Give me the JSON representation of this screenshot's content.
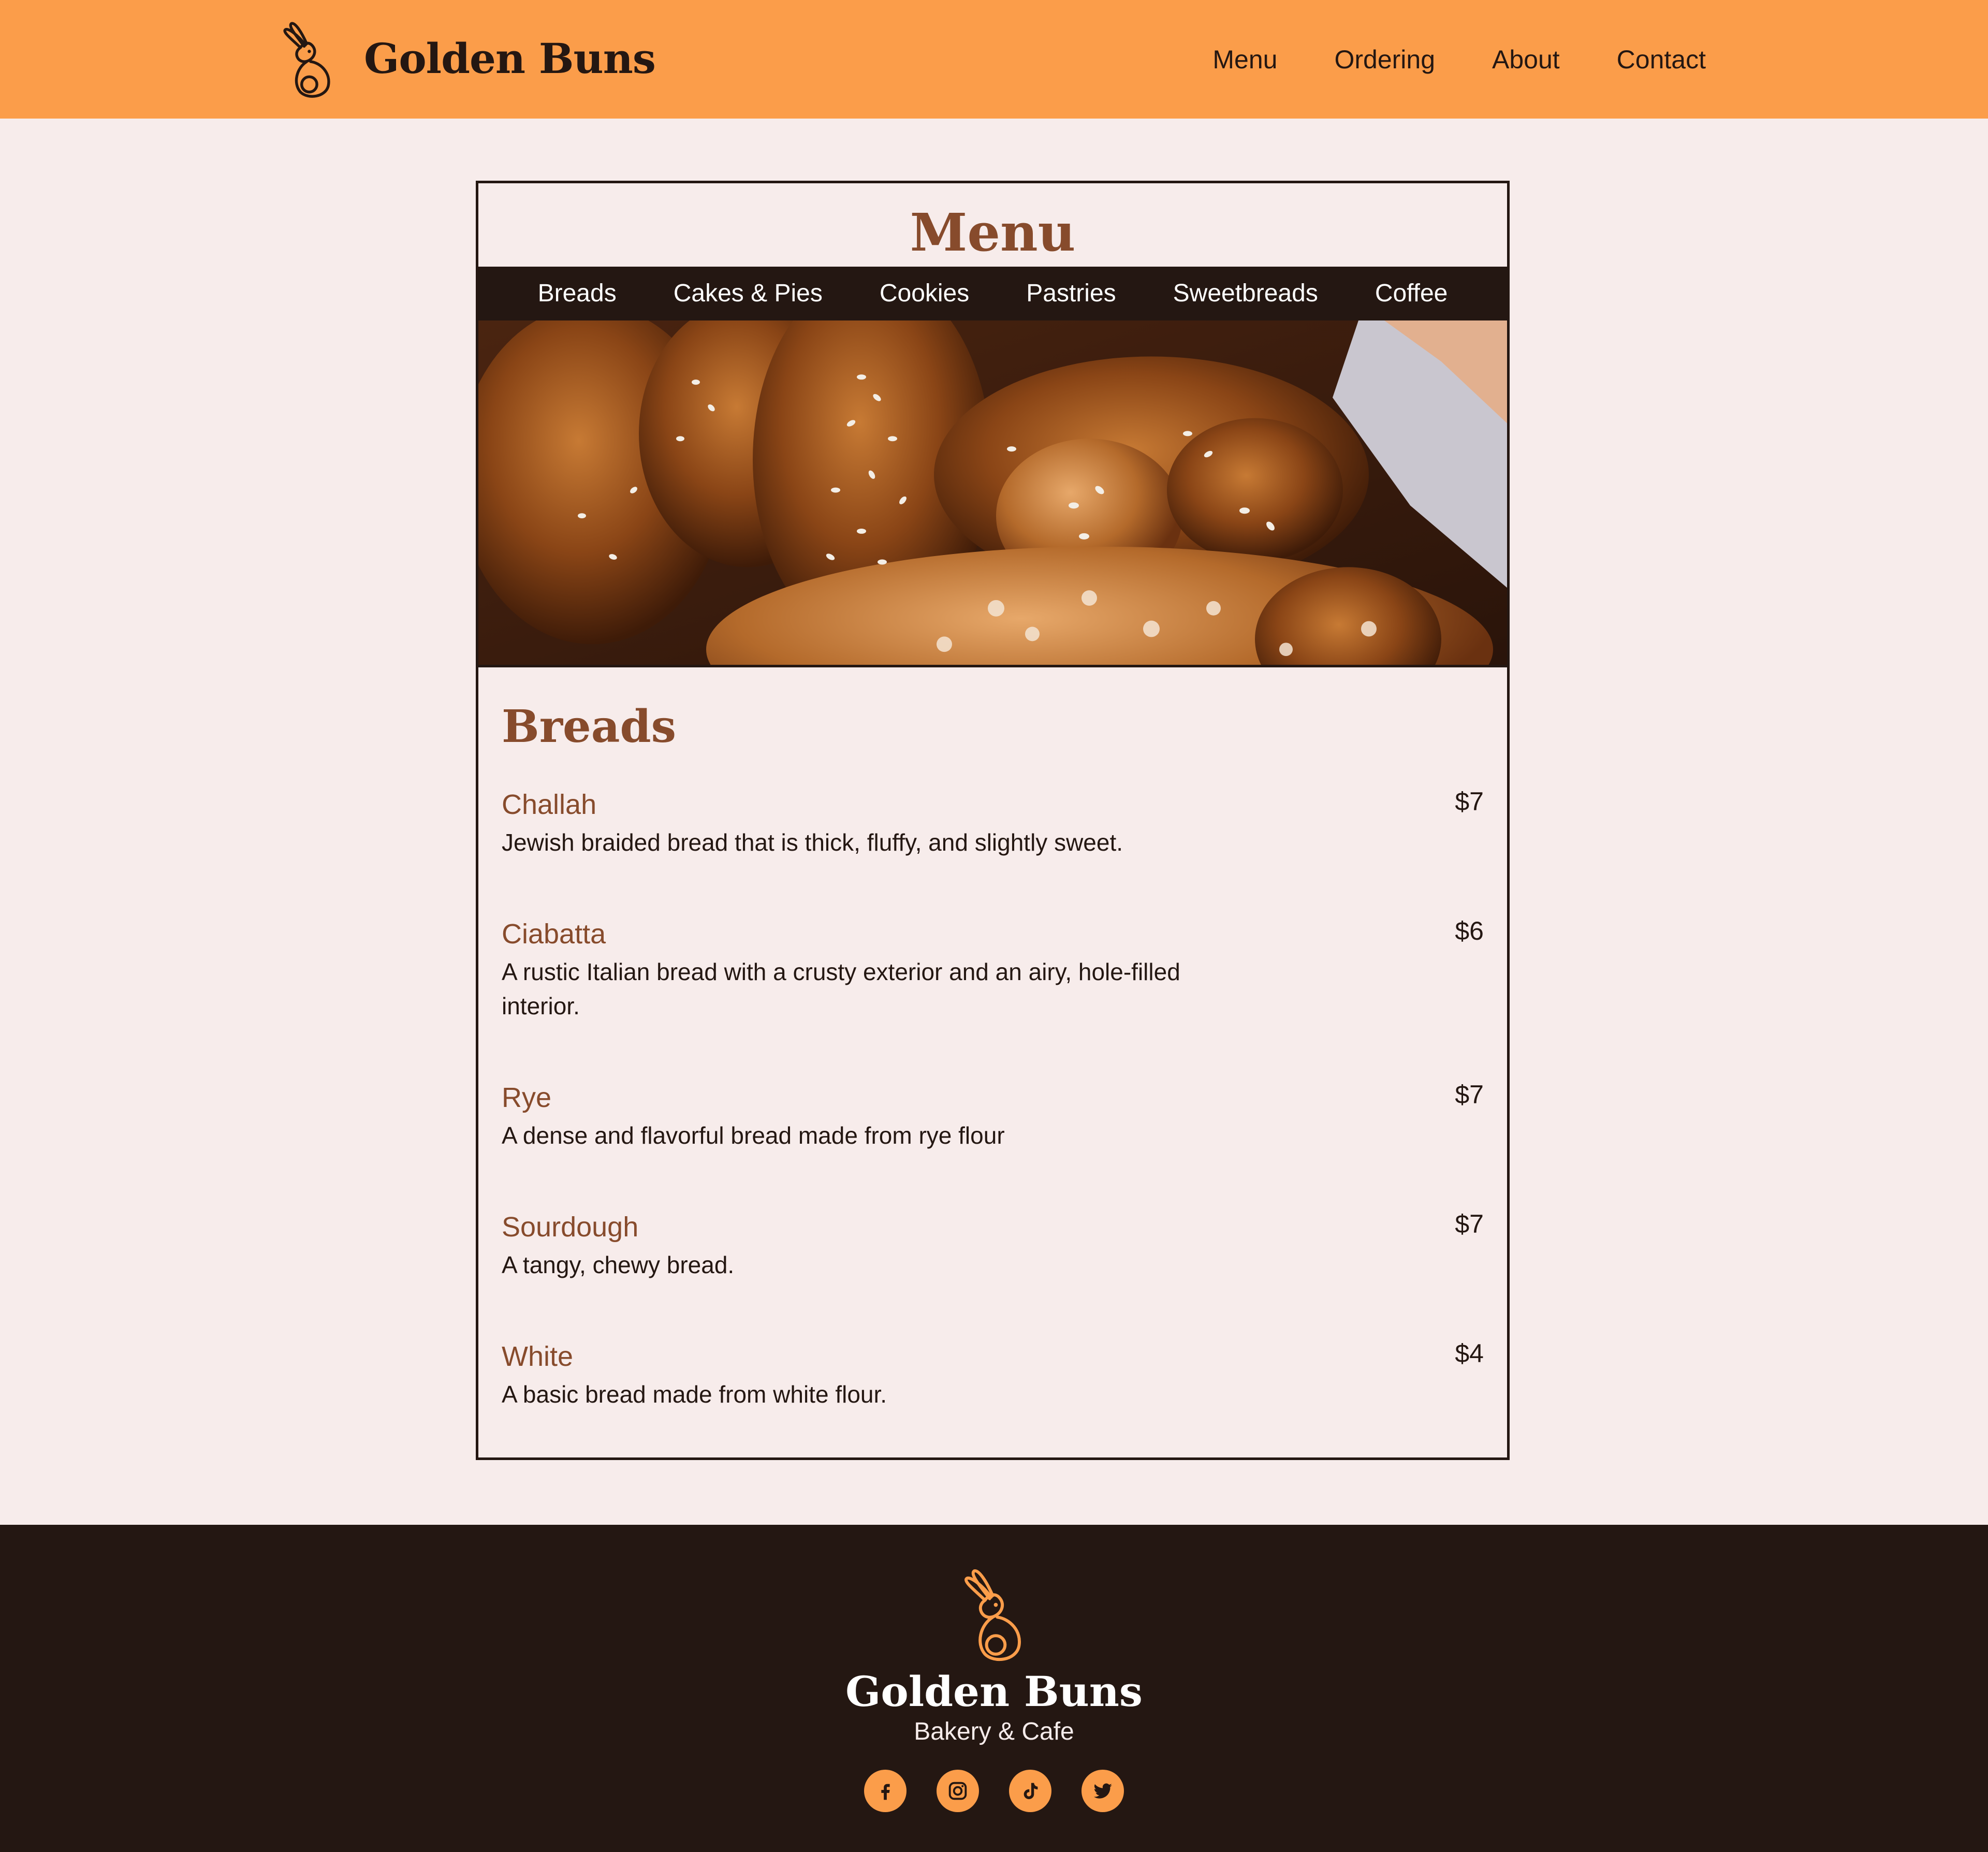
{
  "colors": {
    "header_bg": "#FB9D4A",
    "page_bg": "#F7ECEB",
    "dark": "#241712",
    "accent_brown": "#874B2C"
  },
  "header": {
    "logo_icon": "bunny-logo-icon",
    "brand": "Golden Buns",
    "nav": [
      "Menu",
      "Ordering",
      "About",
      "Contact"
    ]
  },
  "menu": {
    "title": "Menu",
    "tabs": [
      "Breads",
      "Cakes & Pies",
      "Cookies",
      "Pastries",
      "Sweetbreads",
      "Coffee"
    ],
    "hero_image": "braided-challah-photo",
    "section": {
      "title": "Breads",
      "items": [
        {
          "name": "Challah",
          "price": "$7",
          "description": "Jewish braided bread that is thick, fluffy, and slightly sweet."
        },
        {
          "name": "Ciabatta",
          "price": "$6",
          "description": "A rustic Italian bread with a crusty exterior and an airy, hole-filled interior."
        },
        {
          "name": "Rye",
          "price": "$7",
          "description": "A dense and flavorful bread made from rye flour"
        },
        {
          "name": "Sourdough",
          "price": "$7",
          "description": "A tangy, chewy bread."
        },
        {
          "name": "White",
          "price": "$4",
          "description": "A basic bread made from white flour."
        }
      ]
    }
  },
  "footer": {
    "logo_icon": "bunny-logo-icon",
    "brand": "Golden Buns",
    "tagline": "Bakery & Cafe",
    "social": [
      "facebook-icon",
      "instagram-icon",
      "tiktok-icon",
      "twitter-icon"
    ]
  }
}
